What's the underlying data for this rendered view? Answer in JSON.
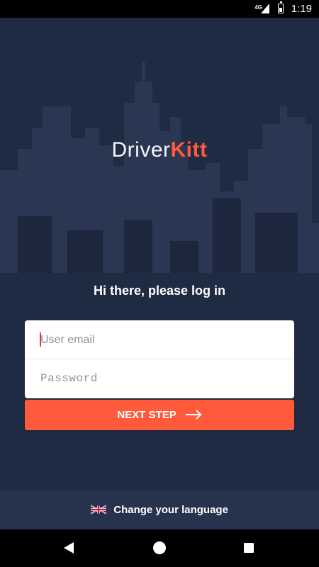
{
  "status_bar": {
    "network": "4G",
    "time": "1:19"
  },
  "logo": {
    "part1": "Driver",
    "part2": "Kitt"
  },
  "login": {
    "greeting": "Hi there, please log in",
    "email_placeholder": "User email",
    "password_placeholder": "Password",
    "next_button": "NEXT STEP"
  },
  "language": {
    "label": "Change your language",
    "flag": "uk-flag-icon"
  },
  "colors": {
    "accent": "#ff5a3c",
    "background": "#1f2b42",
    "skyline": "#2a3652",
    "bottom_bar": "#27334d"
  }
}
